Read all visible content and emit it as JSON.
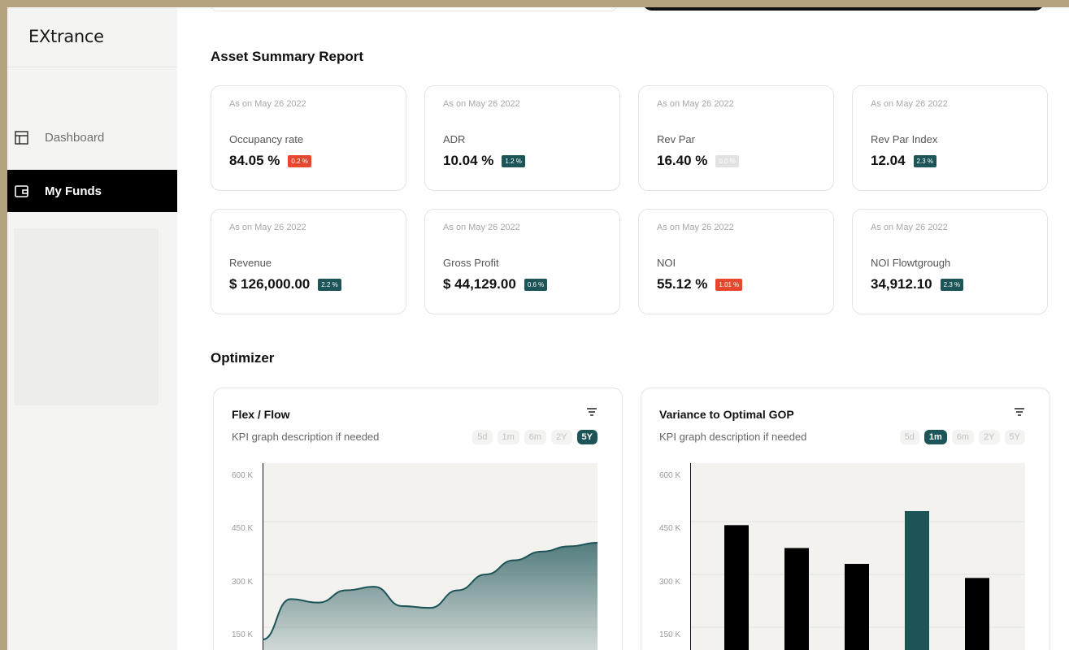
{
  "app": {
    "title": "EXtrance"
  },
  "sidebar": {
    "items": [
      {
        "label": "Dashboard",
        "icon": "layout-icon",
        "active": false
      },
      {
        "label": "My Funds",
        "icon": "wallet-icon",
        "active": true
      }
    ]
  },
  "asset_summary": {
    "title": "Asset Summary Report",
    "cards": [
      {
        "as_of": "As on May 26 2022",
        "name": "Occupancy rate",
        "value": "84.05 %",
        "change": "0.2 %",
        "status": "negative"
      },
      {
        "as_of": "As on May 26 2022",
        "name": "ADR",
        "value": "10.04 %",
        "change": "1.2 %",
        "status": "positive"
      },
      {
        "as_of": "As on May 26 2022",
        "name": "Rev Par",
        "value": "16.40 %",
        "change": "0.0 %",
        "status": "neutral"
      },
      {
        "as_of": "As on May 26 2022",
        "name": "Rev Par Index",
        "value": "12.04",
        "change": "2.3 %",
        "status": "positive"
      },
      {
        "as_of": "As on May 26 2022",
        "name": "Revenue",
        "value": "$ 126,000.00",
        "change": "2.2 %",
        "status": "positive"
      },
      {
        "as_of": "As on May 26 2022",
        "name": "Gross Profit",
        "value": "$ 44,129.00",
        "change": "0.6 %",
        "status": "positive"
      },
      {
        "as_of": "As on May 26 2022",
        "name": "NOI",
        "value": "55.12 %",
        "change": "1.01 %",
        "status": "negative"
      },
      {
        "as_of": "As on May 26 2022",
        "name": "NOI Flowtgrough",
        "value": "34,912.10",
        "change": "2.3 %",
        "status": "positive"
      }
    ]
  },
  "optimizer": {
    "title": "Optimizer",
    "charts": [
      {
        "title": "Flex / Flow",
        "description": "KPI graph description if needed",
        "ranges": [
          "5d",
          "1m",
          "6m",
          "2Y",
          "5Y"
        ],
        "active_range": "5Y"
      },
      {
        "title": "Variance to Optimal GOP",
        "description": "KPI graph description if needed",
        "ranges": [
          "5d",
          "1m",
          "6m",
          "2Y",
          "5Y"
        ],
        "active_range": "1m"
      }
    ]
  },
  "colors": {
    "accent": "#1d5457",
    "negative": "#e8472f",
    "neutral": "#e2e2e2",
    "bar_default": "#000000",
    "frame": "#b5a27e"
  },
  "chart_data": [
    {
      "type": "area",
      "y_ticks": [
        "600 K",
        "450 K",
        "300 K",
        "150 K"
      ],
      "ylim": [
        0,
        600000
      ],
      "x": [
        0,
        1,
        2,
        3,
        4,
        5,
        6,
        7,
        8,
        9,
        10,
        11,
        12
      ],
      "values": [
        115000,
        230000,
        220000,
        255000,
        265000,
        210000,
        205000,
        255000,
        300000,
        340000,
        365000,
        380000,
        390000
      ],
      "grid": true
    },
    {
      "type": "bar",
      "y_ticks": [
        "600 K",
        "450 K",
        "300 K",
        "150 K"
      ],
      "ylim": [
        0,
        600000
      ],
      "values": [
        440000,
        375000,
        330000,
        480000,
        290000
      ],
      "highlight_index": 3,
      "grid": true
    }
  ]
}
